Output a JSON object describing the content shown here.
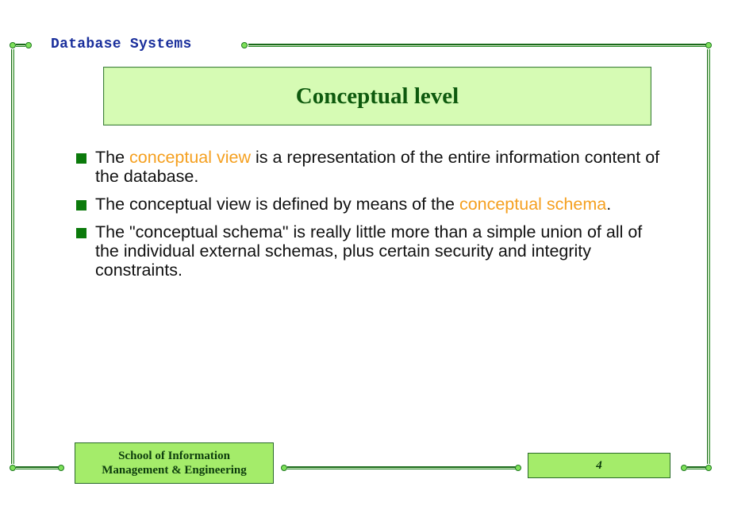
{
  "header": {
    "course_title": "Database Systems"
  },
  "slide": {
    "title": "Conceptual level",
    "bullets": [
      {
        "segments": [
          {
            "text": "The ",
            "highlight": false
          },
          {
            "text": "conceptual view",
            "highlight": true
          },
          {
            "text": " is a representation of the entire information content of the database.",
            "highlight": false
          }
        ]
      },
      {
        "segments": [
          {
            "text": "The conceptual view is defined by means of the ",
            "highlight": false
          },
          {
            "text": "conceptual schema",
            "highlight": true
          },
          {
            "text": ".",
            "highlight": false
          }
        ]
      },
      {
        "segments": [
          {
            "text": "The \"conceptual schema\" is really little more than a simple union of all of the individual external schemas, plus certain security and integrity constraints.",
            "highlight": false
          }
        ]
      }
    ]
  },
  "footer": {
    "school_line1": "School of Information",
    "school_line2": "Management & Engineering",
    "page_number": "4"
  },
  "colors": {
    "highlight": "#f5a020",
    "title_green": "#0e5a0e",
    "header_blue": "#1a2f9c",
    "bullet_green": "#0b7a0b",
    "box_light_green": "#d6fbb4",
    "footer_green": "#a4ec6a"
  }
}
